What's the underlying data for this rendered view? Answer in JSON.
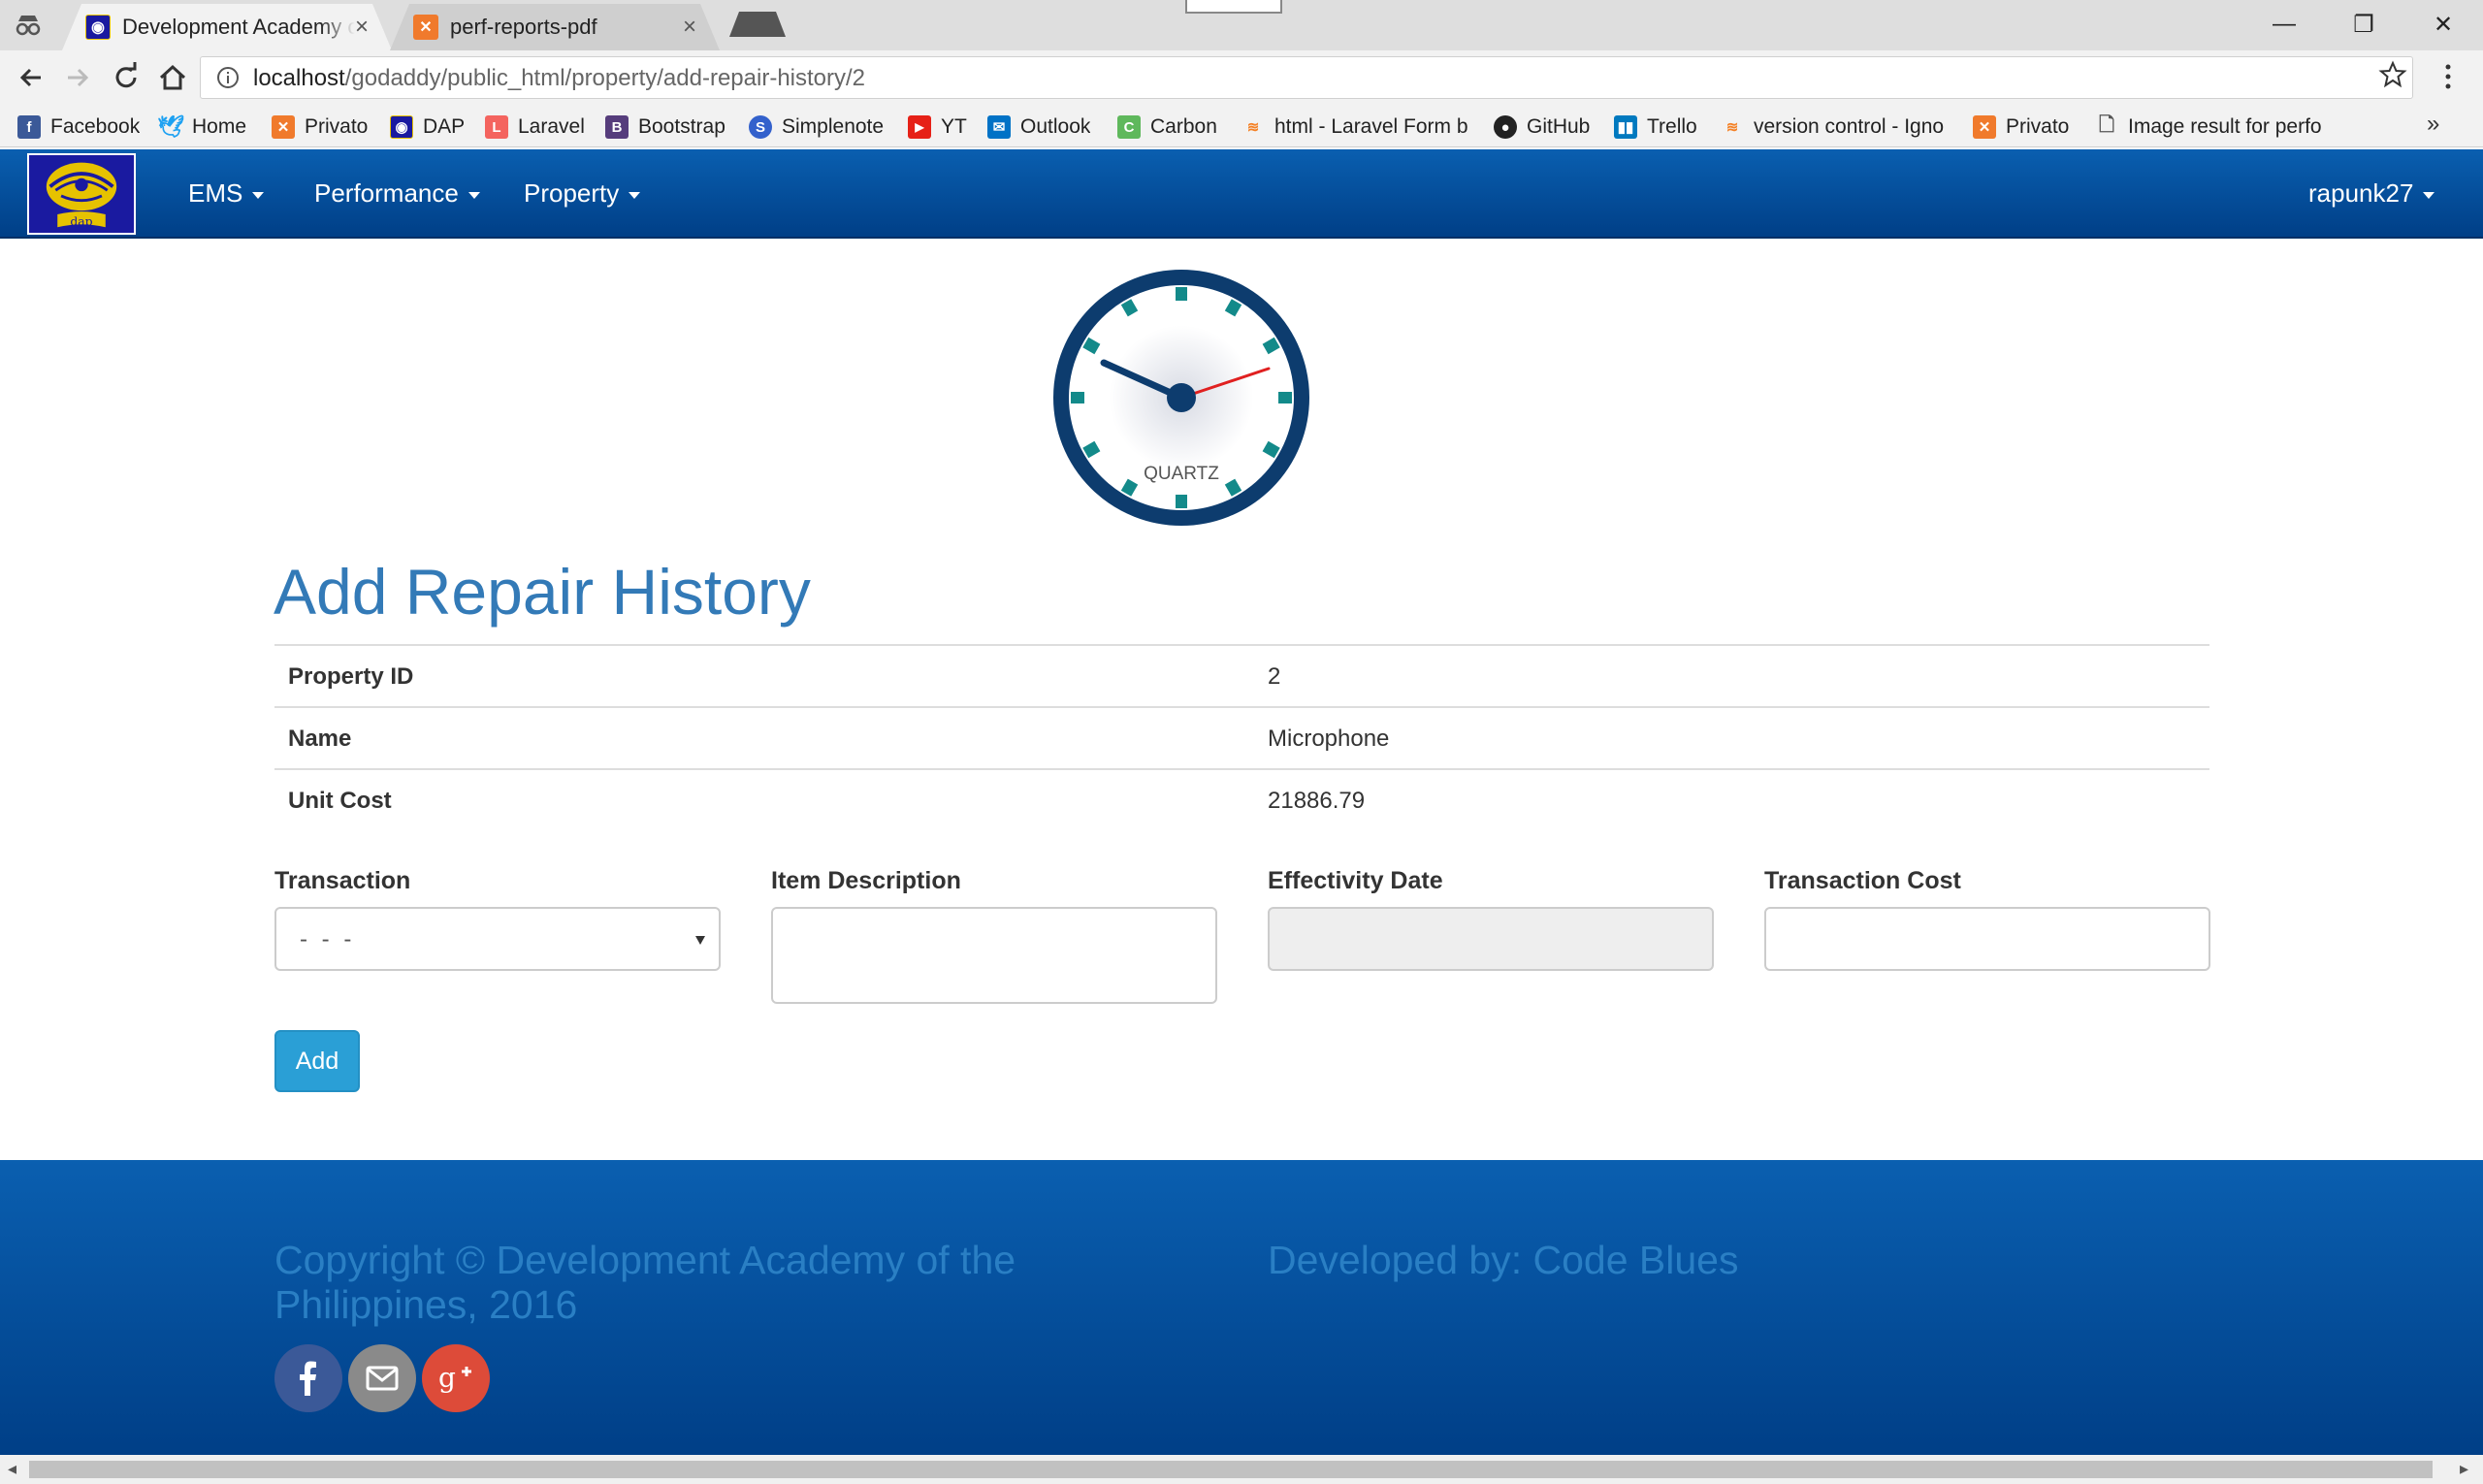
{
  "browser": {
    "tabs": [
      {
        "title": "Development Academy of the Philippines",
        "active": true
      },
      {
        "title": "perf-reports-pdf",
        "active": false
      }
    ],
    "url_host": "localhost",
    "url_path": "/godaddy/public_html/property/add-repair-history/2",
    "bookmarks": [
      {
        "label": "Facebook",
        "icon": "facebook-icon"
      },
      {
        "label": "Home",
        "icon": "twitter-icon"
      },
      {
        "label": "Privato",
        "icon": "xampp-icon"
      },
      {
        "label": "DAP",
        "icon": "dap-icon"
      },
      {
        "label": "Laravel",
        "icon": "laravel-icon"
      },
      {
        "label": "Bootstrap",
        "icon": "bootstrap-icon"
      },
      {
        "label": "Simplenote",
        "icon": "simplenote-icon"
      },
      {
        "label": "YT",
        "icon": "youtube-icon"
      },
      {
        "label": "Outlook",
        "icon": "outlook-icon"
      },
      {
        "label": "Carbon",
        "icon": "carbon-icon"
      },
      {
        "label": "html - Laravel Form b",
        "icon": "stackoverflow-icon"
      },
      {
        "label": "GitHub",
        "icon": "github-icon"
      },
      {
        "label": "Trello",
        "icon": "trello-icon"
      },
      {
        "label": "version control - Igno",
        "icon": "stackoverflow-icon"
      },
      {
        "label": "Privato",
        "icon": "xampp-icon"
      },
      {
        "label": "Image result for perfo",
        "icon": "page-icon"
      }
    ]
  },
  "navbar": {
    "menus": [
      "EMS",
      "Performance",
      "Property"
    ],
    "user": "rapunk27"
  },
  "clock": {
    "label": "QUARTZ"
  },
  "page": {
    "title": "Add Repair History",
    "details": [
      {
        "key": "Property ID",
        "value": "2"
      },
      {
        "key": "Name",
        "value": "Microphone"
      },
      {
        "key": "Unit Cost",
        "value": "21886.79"
      }
    ]
  },
  "form": {
    "transaction_label": "Transaction",
    "transaction_value": "- - -",
    "item_description_label": "Item Description",
    "effectivity_date_label": "Effectivity Date",
    "transaction_cost_label": "Transaction Cost",
    "submit_label": "Add"
  },
  "footer": {
    "copyright": "Copyright © Development Academy of the Philippines, 2016",
    "developer": "Developed by: Code Blues"
  },
  "colors": {
    "navbar": "#0a5fb0",
    "title": "#337ab7",
    "button": "#2a9fd6",
    "footer_text": "#2a7fc4"
  }
}
